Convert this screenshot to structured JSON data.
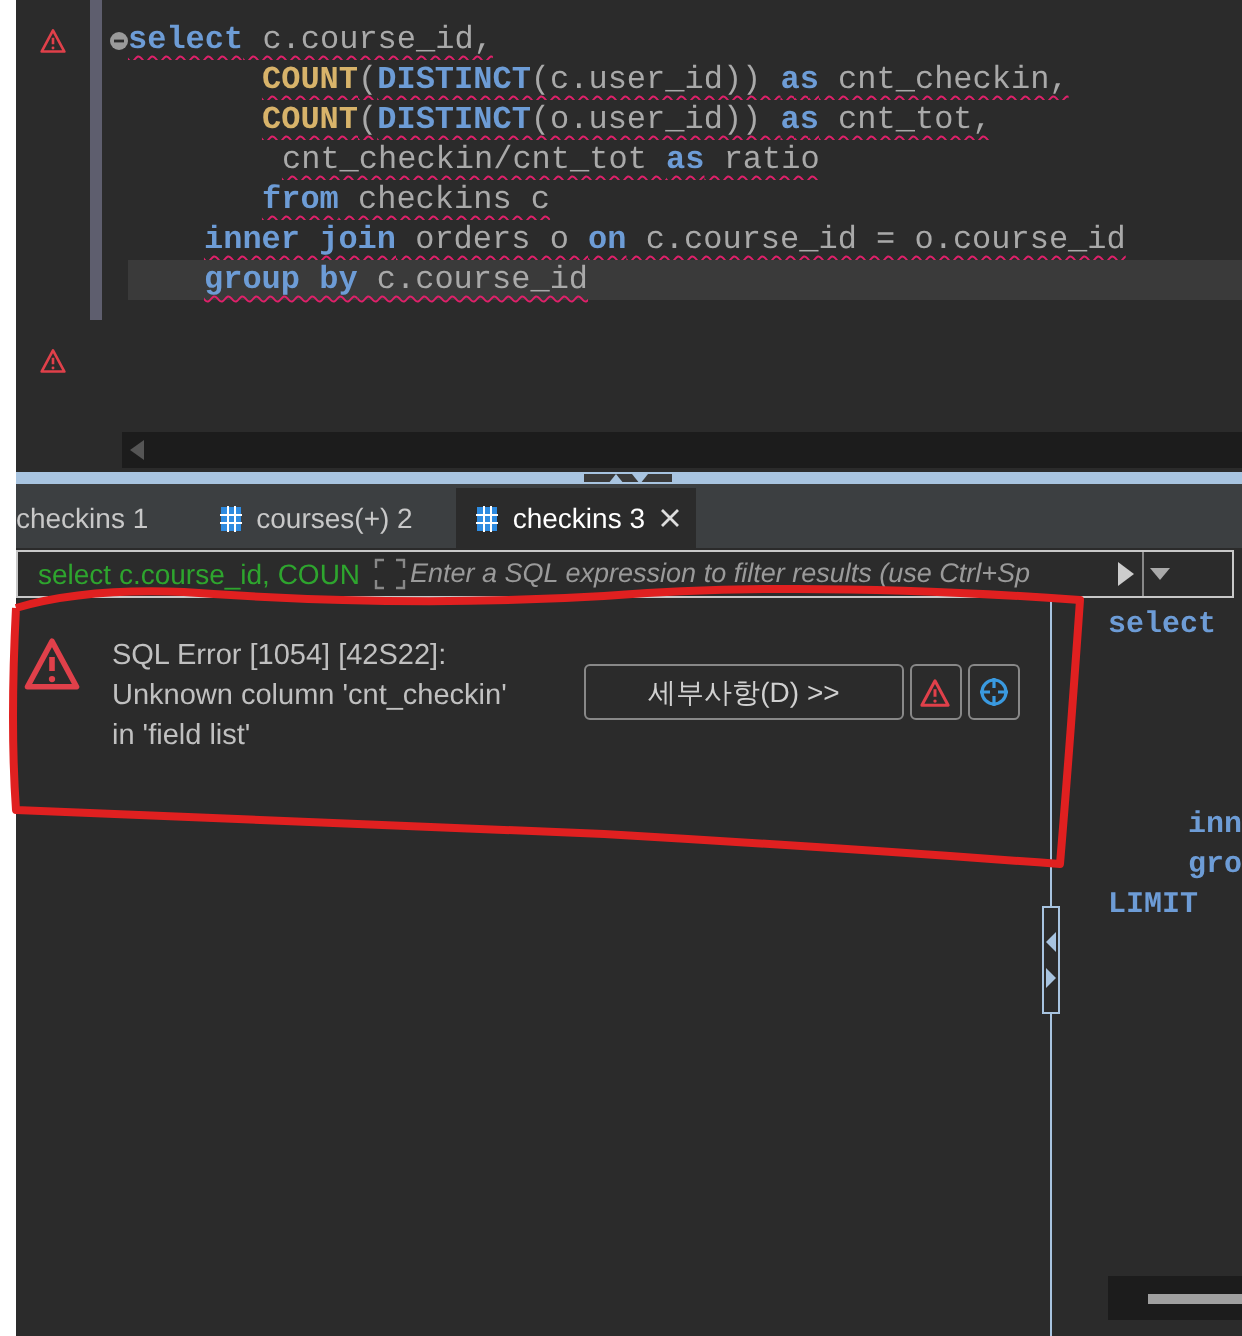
{
  "editor": {
    "gutter": [
      {
        "kind": "error"
      },
      {
        "kind": "none"
      },
      {
        "kind": "none"
      },
      {
        "kind": "none"
      },
      {
        "kind": "none"
      },
      {
        "kind": "none"
      },
      {
        "kind": "none"
      },
      {
        "kind": "none"
      },
      {
        "kind": "error"
      }
    ],
    "lines": [
      {
        "current": false,
        "tokens": [
          {
            "kind": "keyword",
            "text": "select"
          },
          {
            "kind": "plain",
            "text": " c.course_id,"
          }
        ]
      },
      {
        "current": false,
        "tokens": [
          {
            "kind": "function",
            "text": "COUNT"
          },
          {
            "kind": "plain",
            "text": "("
          },
          {
            "kind": "keyword",
            "text": "DISTINCT"
          },
          {
            "kind": "plain",
            "text": "(c.user_id)) "
          },
          {
            "kind": "keyword",
            "text": "as"
          },
          {
            "kind": "plain",
            "text": " cnt_checkin,"
          }
        ]
      },
      {
        "current": false,
        "tokens": [
          {
            "kind": "function",
            "text": "COUNT"
          },
          {
            "kind": "plain",
            "text": "("
          },
          {
            "kind": "keyword",
            "text": "DISTINCT"
          },
          {
            "kind": "plain",
            "text": "(o.user_id)) "
          },
          {
            "kind": "keyword",
            "text": "as"
          },
          {
            "kind": "plain",
            "text": " cnt_tot,"
          }
        ]
      },
      {
        "current": false,
        "tokens": [
          {
            "kind": "plain",
            "text": "cnt_checkin/cnt_tot "
          },
          {
            "kind": "keyword",
            "text": "as"
          },
          {
            "kind": "plain",
            "text": " ratio"
          }
        ]
      },
      {
        "current": false,
        "tokens": [
          {
            "kind": "keyword",
            "text": "from"
          },
          {
            "kind": "plain",
            "text": " checkins c"
          }
        ]
      },
      {
        "current": false,
        "tokens": [
          {
            "kind": "keyword",
            "text": "inner join"
          },
          {
            "kind": "plain",
            "text": " orders o "
          },
          {
            "kind": "keyword",
            "text": "on"
          },
          {
            "kind": "plain",
            "text": " c.course_id = o.course_id"
          }
        ]
      },
      {
        "current": true,
        "tokens": [
          {
            "kind": "keyword",
            "text": "group by"
          },
          {
            "kind": "plain",
            "text": " c.course_id"
          }
        ]
      }
    ]
  },
  "tabs": [
    {
      "label": "checkins 1",
      "selected": false
    },
    {
      "label": "courses(+) 2",
      "selected": false
    },
    {
      "label": "checkins 3",
      "selected": true
    }
  ],
  "filter": {
    "query": "select c.course_id, COUN",
    "placeholder": "Enter a SQL expression to filter results (use Ctrl+Sp"
  },
  "error": {
    "lines": [
      "SQL Error [1054] [42S22]:",
      "Unknown column 'cnt_checkin'",
      "in 'field list'"
    ],
    "details_button": "세부사항(D) >>"
  },
  "side_panel": {
    "lines": [
      "select",
      "inn",
      "gro",
      "LIMIT"
    ]
  }
}
